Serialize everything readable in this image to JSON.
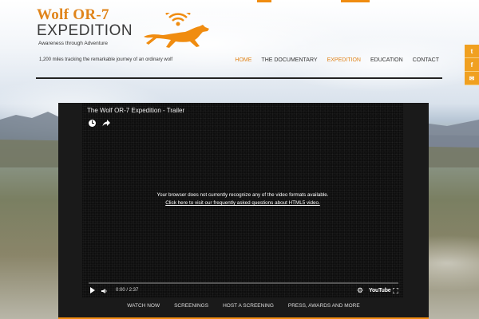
{
  "brand": {
    "line1": "Wolf OR-7",
    "line2": "EXPEDITION",
    "tagline_small": "Awareness through Adventure",
    "accent": "#e0841a"
  },
  "tagline": "1,200 miles tracking the remarkable journey of an ordinary wolf",
  "nav": {
    "items": [
      "HOME",
      "THE DOCUMENTARY",
      "EXPEDITION",
      "EDUCATION",
      "CONTACT"
    ],
    "active": [
      "HOME",
      "EXPEDITION"
    ]
  },
  "social": [
    {
      "icon": "twitter-icon",
      "glyph": "t"
    },
    {
      "icon": "facebook-icon",
      "glyph": "f"
    },
    {
      "icon": "email-icon",
      "glyph": "✉"
    }
  ],
  "video": {
    "title": "The Wolf OR-7 Expedition - Trailer",
    "message": "Your browser does not currently recognize any of the video formats available.",
    "link": "Click here to visit our frequently asked questions about HTML5 video.",
    "time": "0:00 / 2:37",
    "brand": "YouTube"
  },
  "subnav": {
    "items": [
      "WATCH NOW",
      "SCREENINGS",
      "HOST A SCREENING",
      "PRESS, AWARDS AND MORE"
    ]
  }
}
